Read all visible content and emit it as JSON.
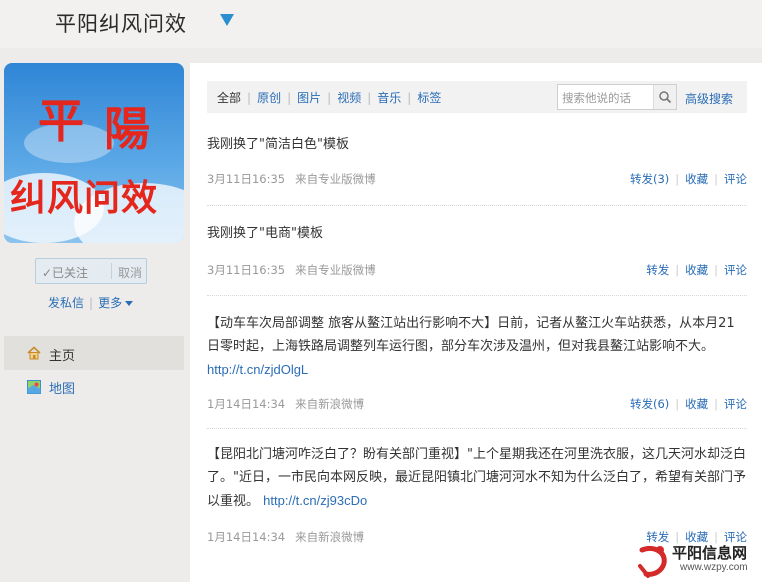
{
  "header": {
    "title": "平阳纠风问效"
  },
  "profile": {
    "avatar_line1a": "平",
    "avatar_line1b": "陽",
    "avatar_line2": "纠风问效",
    "followed_label": "✓已关注",
    "cancel_label": "取消",
    "message_label": "发私信",
    "more_label": "更多"
  },
  "nav": {
    "home_label": "主页",
    "map_label": "地图"
  },
  "filters": {
    "items": [
      "全部",
      "原创",
      "图片",
      "视频",
      "音乐",
      "标签"
    ],
    "search_placeholder": "搜索他说的话",
    "advanced_label": "高级搜索"
  },
  "posts": [
    {
      "text": "我刚换了\"简洁白色\"模板",
      "link": "",
      "time": "3月11日16:35",
      "source": "来自专业版微博",
      "forward": "转发(3)",
      "favorite": "收藏",
      "comment": "评论"
    },
    {
      "text": "我刚换了\"电商\"模板",
      "link": "",
      "time": "3月11日16:35",
      "source": "来自专业版微博",
      "forward": "转发",
      "favorite": "收藏",
      "comment": "评论"
    },
    {
      "text": "【动车车次局部调整 旅客从鳌江站出行影响不大】日前，记者从鳌江火车站获悉，从本月21日零时起，上海铁路局调整列车运行图，部分车次涉及温州，但对我县鳌江站影响不大。",
      "link": "http://t.cn/zjdOlgL",
      "time": "1月14日14:34",
      "source": "来自新浪微博",
      "forward": "转发(6)",
      "favorite": "收藏",
      "comment": "评论"
    },
    {
      "text": "【昆阳北门塘河咋泛白了？盼有关部门重视】\"上个星期我还在河里洗衣服，这几天河水却泛白了。\"近日，一市民向本网反映，最近昆阳镇北门塘河河水不知为什么泛白了，希望有关部门予以重视。",
      "link": "http://t.cn/zj93cDo",
      "time": "1月14日14:34",
      "source": "来自新浪微博",
      "forward": "转发",
      "favorite": "收藏",
      "comment": "评论"
    }
  ],
  "watermark": {
    "name": "平阳信息网",
    "url": "www.wzpy.com"
  },
  "colors": {
    "accent": "#2a6db6",
    "title_arrow": "#2a8fd0",
    "avatar_text": "#e4261c"
  },
  "icons": {
    "home": "home-icon",
    "map": "map-icon",
    "search": "search-icon",
    "title_dropdown": "chevron-down-icon"
  }
}
